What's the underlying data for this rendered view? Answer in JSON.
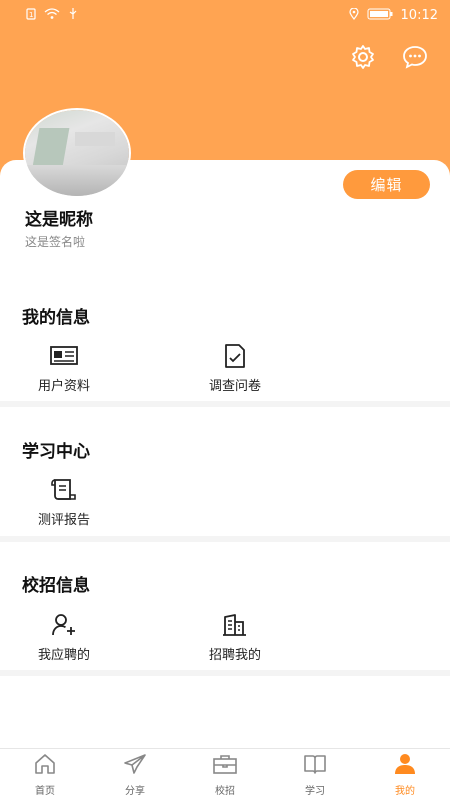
{
  "status": {
    "time": "10:12"
  },
  "profile": {
    "nickname": "这是昵称",
    "signature": "这是签名啦",
    "edit_label": "编辑"
  },
  "sections": [
    {
      "title": "我的信息",
      "items": [
        {
          "label": "用户资料",
          "icon": "id-card-icon"
        },
        {
          "label": "调查问卷",
          "icon": "survey-icon"
        }
      ]
    },
    {
      "title": "学习中心",
      "items": [
        {
          "label": "测评报告",
          "icon": "report-scroll-icon"
        }
      ]
    },
    {
      "title": "校招信息",
      "items": [
        {
          "label": "我应聘的",
          "icon": "user-add-icon"
        },
        {
          "label": "招聘我的",
          "icon": "building-icon"
        }
      ]
    }
  ],
  "tabs": [
    {
      "label": "首页",
      "icon": "home-icon",
      "active": false
    },
    {
      "label": "分享",
      "icon": "paper-plane-icon",
      "active": false
    },
    {
      "label": "校招",
      "icon": "briefcase-icon",
      "active": false
    },
    {
      "label": "学习",
      "icon": "book-icon",
      "active": false
    },
    {
      "label": "我的",
      "icon": "person-icon",
      "active": true
    }
  ],
  "colors": {
    "accent": "#FFA452",
    "button": "#FF9A3D",
    "active_tab": "#FF8A1F"
  }
}
